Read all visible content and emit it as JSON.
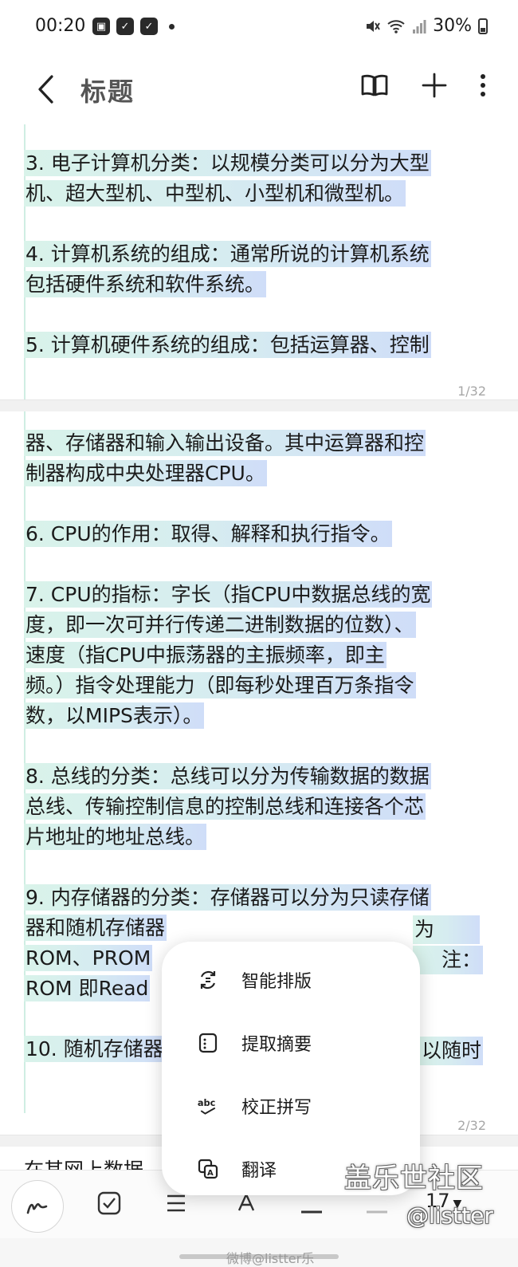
{
  "status": {
    "time": "00:20",
    "battery": "30%",
    "icons": [
      "gallery-icon",
      "check-app-icon",
      "check-app-icon",
      "dot-icon"
    ],
    "right_icons": [
      "mute-icon",
      "wifi-icon",
      "signal-icon",
      "battery-icon"
    ]
  },
  "appbar": {
    "title": "标题",
    "icons": [
      "back-icon",
      "book-icon",
      "plus-icon",
      "more-icon"
    ]
  },
  "pages": [
    {
      "number": "1/32",
      "lines": [
        "3. 电子计算机分类：以规模分类可以分为大型",
        "机、超大型机、中型机、小型机和微型机。",
        "",
        "4. 计算机系统的组成：通常所说的计算机系统",
        "包括硬件系统和软件系统。",
        "",
        "5. 计算机硬件系统的组成：包括运算器、控制"
      ]
    },
    {
      "number": "2/32",
      "lines": [
        "器、存储器和输入输出设备。其中运算器和控",
        "制器构成中央处理器CPU。",
        "",
        "6. CPU的作用：取得、解释和执行指令。",
        "",
        "7. CPU的指标：字长（指CPU中数据总线的宽",
        "度，即一次可并行传递二进制数据的位数）、",
        "速度（指CPU中振荡器的主振频率，即主",
        "频。）指令处理能力（即每秒处理百万条指令",
        "数，以MIPS表示）。",
        "",
        "8. 总线的分类：总线可以分为传输数据的数据",
        "总线、传输控制信息的控制总线和连接各个芯",
        "片地址的地址总线。",
        "",
        "9. 内存储器的分类：存储器可以分为只读存储",
        "器和随机存储器",
        "ROM、PROM",
        "ROM 即Read",
        "",
        "10. 随机存储器"
      ],
      "partial_right": {
        "line16": "为",
        "line17": "注：",
        "line20": "以随时"
      }
    }
  ],
  "page3_peek": "在其网上数据",
  "context_menu": {
    "items": [
      {
        "label": "智能排版",
        "icon": "smart-layout-icon"
      },
      {
        "label": "提取摘要",
        "icon": "extract-summary-icon"
      },
      {
        "label": "校正拼写",
        "icon": "spell-check-icon"
      },
      {
        "label": "翻译",
        "icon": "translate-icon"
      }
    ]
  },
  "toolbar": {
    "font_size": "17",
    "items": [
      "pen-icon",
      "checkbox-icon",
      "list-icon",
      "text-format-icon",
      "line-icon",
      "more-format-icon"
    ]
  },
  "watermark": {
    "line1": "盖乐世社区",
    "line2": "@listter",
    "line3": "微博@listter乐"
  },
  "colors": {
    "highlight_start": "#d9f3ea",
    "highlight_end": "#cfddf8",
    "page_divider": "#f1f1f1"
  }
}
